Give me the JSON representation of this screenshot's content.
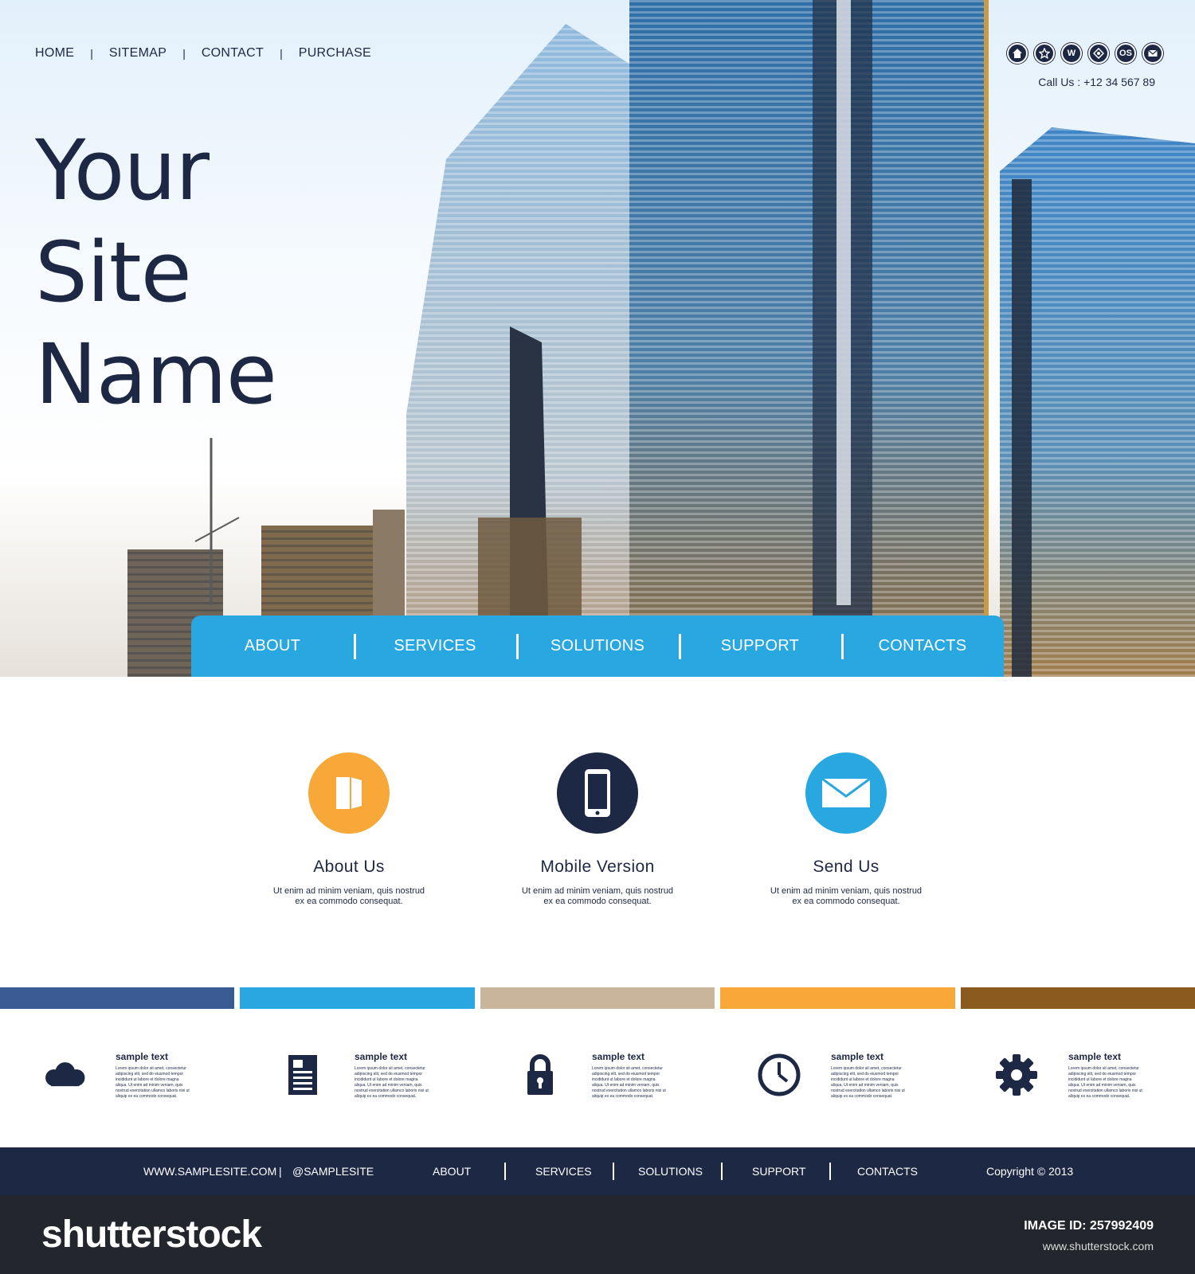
{
  "top_nav": {
    "items": [
      "HOME",
      "SITEMAP",
      "CONTACT",
      "PURCHASE"
    ],
    "separator": "|"
  },
  "header": {
    "social_icons": [
      "home-icon",
      "star-icon",
      "w-icon",
      "globe-icon",
      "os-icon",
      "mail-icon"
    ],
    "social_labels": [
      "",
      "",
      "W",
      "",
      "OS",
      ""
    ],
    "call": "Call Us : +12 34 567 89"
  },
  "hero": {
    "title_lines": [
      "Your",
      "Site",
      "Name"
    ]
  },
  "main_nav": {
    "items": [
      "ABOUT",
      "SERVICES",
      "SOLUTIONS",
      "SUPPORT",
      "CONTACTS"
    ]
  },
  "features": [
    {
      "icon": "book-icon",
      "color": "#f7a839",
      "title": "About Us",
      "line1": "Ut enim ad minim veniam, quis nostrud",
      "line2": "ex ea commodo consequat."
    },
    {
      "icon": "tablet-icon",
      "color": "#1d2845",
      "title": "Mobile Version",
      "line1": "Ut enim ad minim veniam, quis nostrud",
      "line2": "ex ea commodo consequat."
    },
    {
      "icon": "envelope-icon",
      "color": "#29a7e1",
      "title": "Send Us",
      "line1": "Ut enim ad minim veniam, quis nostrud",
      "line2": "ex ea commodo consequat."
    }
  ],
  "color_bar": [
    "#3a5a93",
    "#29a7e1",
    "#c8b59b",
    "#f7a839",
    "#8b5a1e"
  ],
  "info_blocks": [
    {
      "icon": "cloud-icon",
      "title": "sample text",
      "text": "Lorem ipsum dolor sit amet, consectetur adipiscing elit, sed do eiusmod tempor incididunt ut labore et dolore magna aliqua. Ut enim ad minim veniam, quis nostrud exercitation ullamco laboris nisi ut aliquip ex ea commodo consequat."
    },
    {
      "icon": "document-icon",
      "title": "sample text",
      "text": "Lorem ipsum dolor sit amet, consectetur adipiscing elit, sed do eiusmod tempor incididunt ut labore et dolore magna aliqua. Ut enim ad minim veniam, quis nostrud exercitation ullamco laboris nisi ut aliquip ex ea commodo consequat."
    },
    {
      "icon": "lock-icon",
      "title": "sample text",
      "text": "Lorem ipsum dolor sit amet, consectetur adipiscing elit, sed do eiusmod tempor incididunt ut labore et dolore magna aliqua. Ut enim ad minim veniam, quis nostrud exercitation ullamco laboris nisi ut aliquip ex ea commodo consequat."
    },
    {
      "icon": "clock-icon",
      "title": "sample text",
      "text": "Lorem ipsum dolor sit amet, consectetur adipiscing elit, sed do eiusmod tempor incididunt ut labore et dolore magna aliqua. Ut enim ad minim veniam, quis nostrud exercitation ullamco laboris nisi ut aliquip ex ea commodo consequat."
    },
    {
      "icon": "gear-icon",
      "title": "sample text",
      "text": "Lorem ipsum dolor sit amet, consectetur adipiscing elit, sed do eiusmod tempor incididunt ut labore et dolore magna aliqua. Ut enim ad minim veniam, quis nostrud exercitation ullamco laboris nisi ut aliquip ex ea commodo consequat."
    }
  ],
  "footer": {
    "website": "WWW.SAMPLESITE.COM",
    "divider": "|",
    "handle": "@SAMPLESITE",
    "nav": [
      "ABOUT",
      "SERVICES",
      "SOLUTIONS",
      "SUPPORT",
      "CONTACTS"
    ],
    "copyright": "Copyright © 2013"
  },
  "watermark": {
    "logo": "shutterstock",
    "image_id": "IMAGE ID: 257992409",
    "url": "www.shutterstock.com"
  },
  "colors": {
    "navy": "#1d2845",
    "blue": "#29a7e1",
    "orange": "#f7a839"
  }
}
